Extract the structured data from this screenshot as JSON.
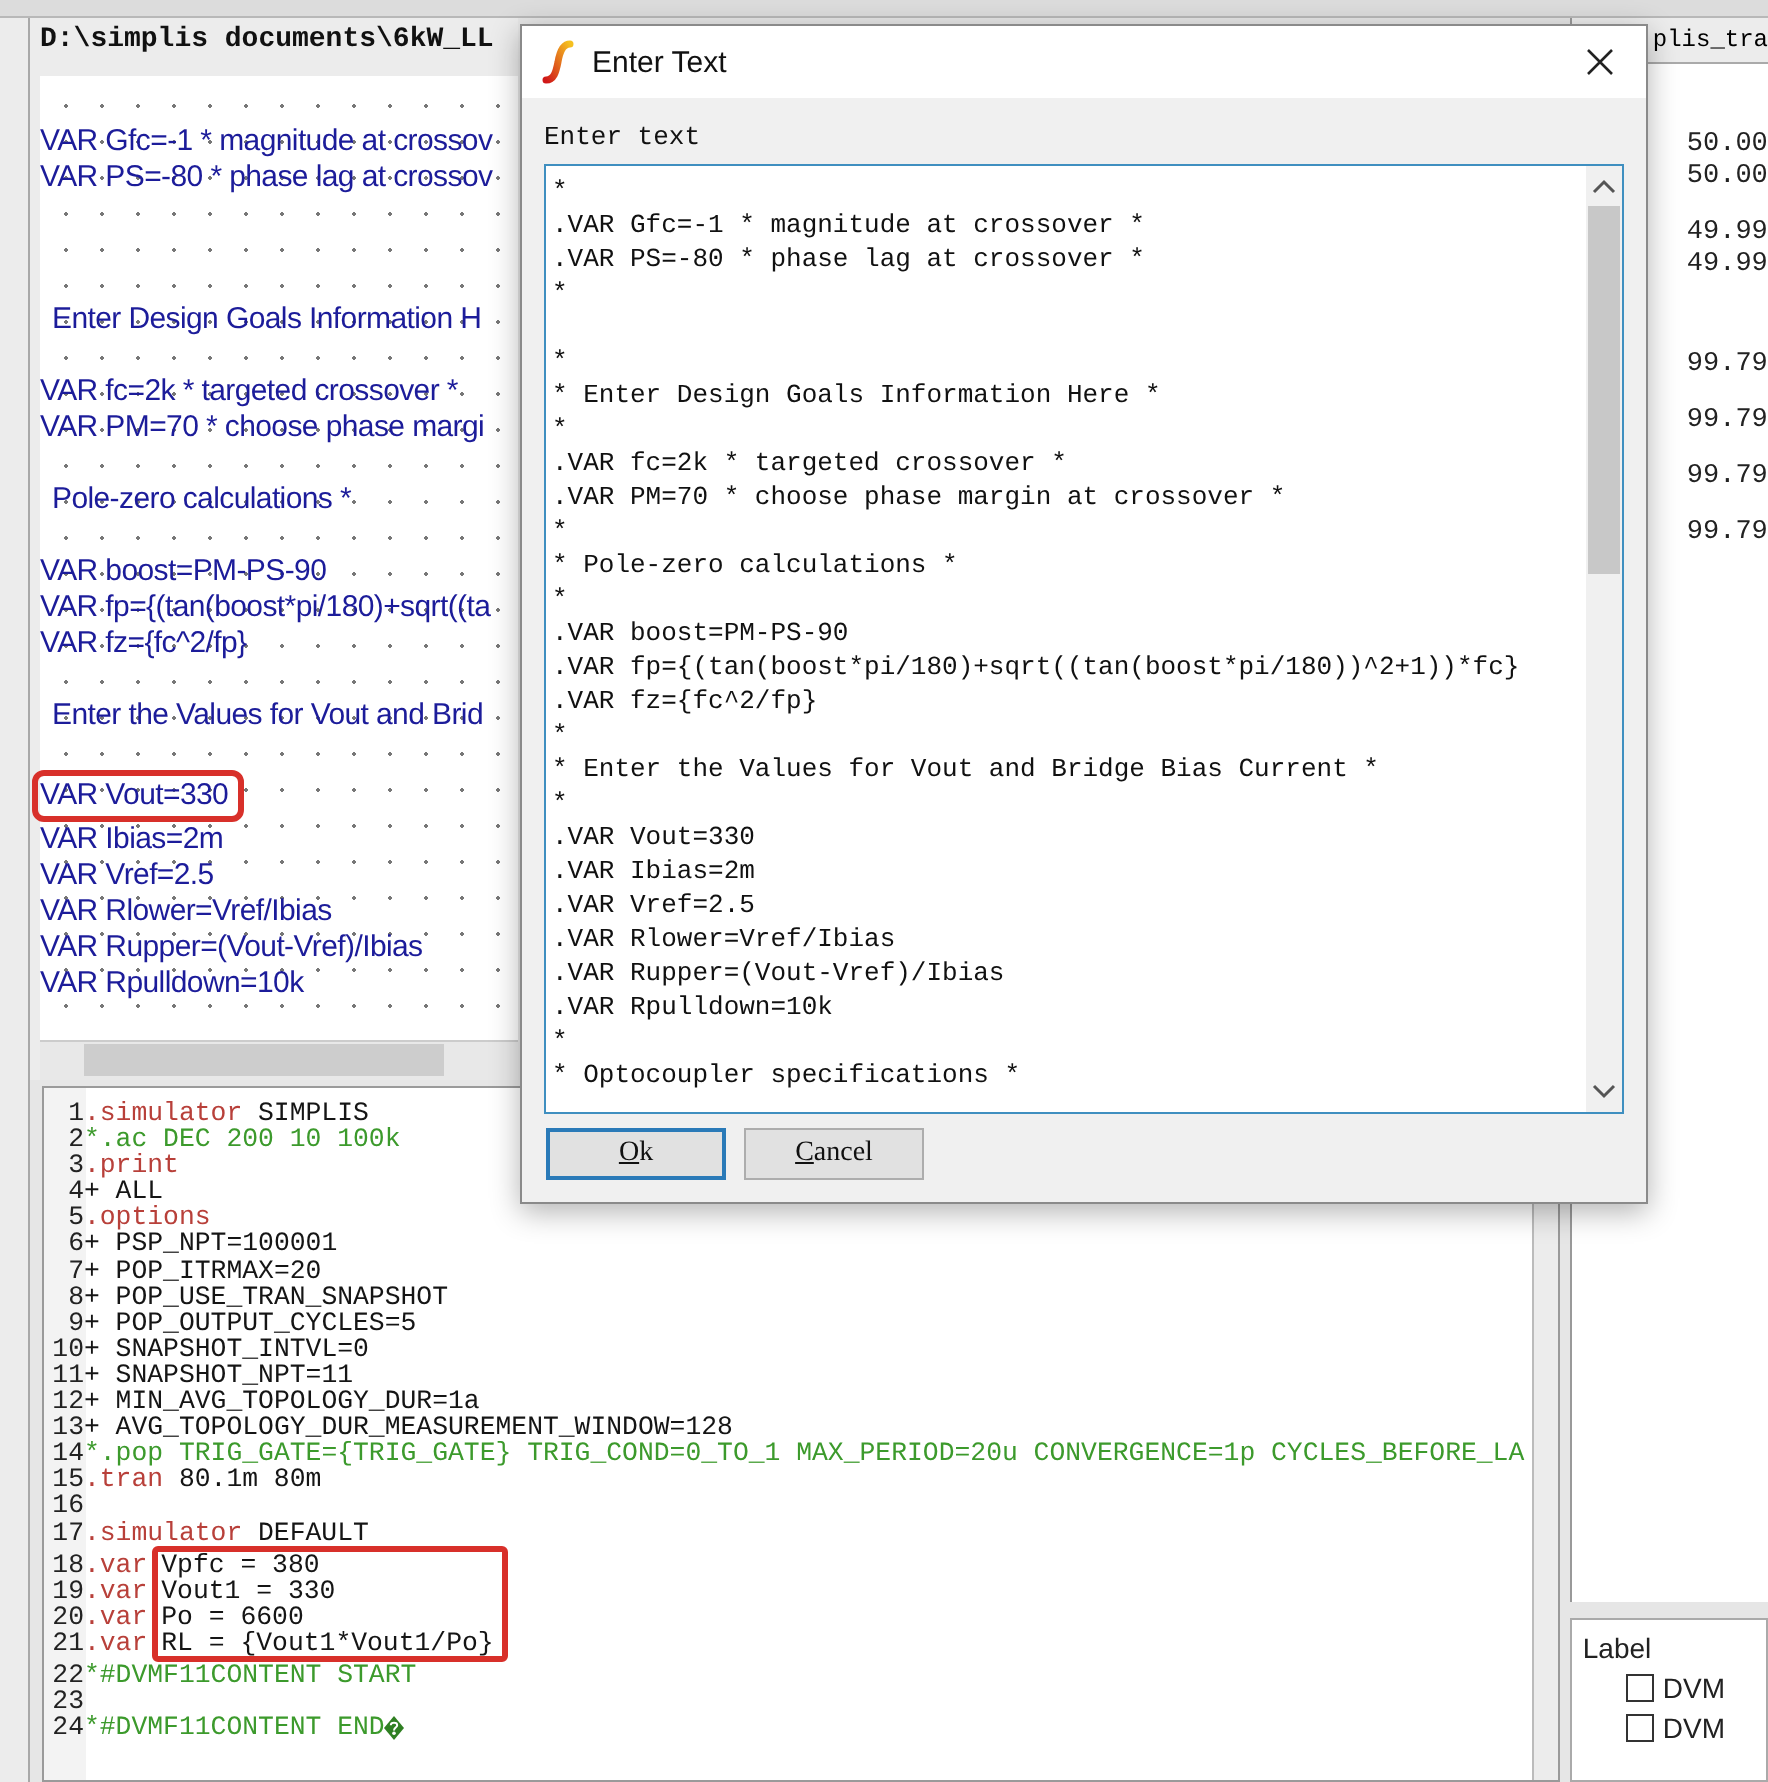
{
  "schematic": {
    "title": "D:\\simplis documents\\6kW_LL",
    "blocks": [
      {
        "lines": [
          {
            "kind": "var",
            "text": "VAR Gfc=-1 * magnitude at crossov"
          },
          {
            "kind": "var",
            "text": "VAR PS=-80 * phase lag at crossov"
          }
        ]
      },
      {
        "lines": [
          {
            "kind": "heading",
            "text": "Enter Design Goals Information H"
          }
        ]
      },
      {
        "lines": [
          {
            "kind": "var",
            "text": "VAR fc=2k * targeted crossover *"
          },
          {
            "kind": "var",
            "text": "VAR PM=70 * choose phase margi"
          }
        ]
      },
      {
        "lines": [
          {
            "kind": "heading",
            "text": "Pole-zero calculations *"
          }
        ]
      },
      {
        "lines": [
          {
            "kind": "var",
            "text": "VAR boost=PM-PS-90"
          },
          {
            "kind": "var",
            "text": "VAR fp={(tan(boost*pi/180)+sqrt((ta"
          },
          {
            "kind": "var",
            "text": "VAR fz={fc^2/fp}"
          }
        ]
      },
      {
        "lines": [
          {
            "kind": "heading",
            "text": "Enter the Values for Vout and Brid"
          }
        ]
      },
      {
        "lines": [
          {
            "kind": "var",
            "text": "VAR Vout=330",
            "highlighted": true
          },
          {
            "kind": "var",
            "text": "VAR Ibias=2m"
          },
          {
            "kind": "var",
            "text": "VAR Vref=2.5"
          },
          {
            "kind": "var",
            "text": "VAR Rlower=Vref/Ibias"
          },
          {
            "kind": "var",
            "text": "VAR Rupper=(Vout-Vref)/Ibias"
          },
          {
            "kind": "var",
            "text": "VAR Rpulldown=10k"
          }
        ]
      }
    ]
  },
  "code_editor": {
    "lines": [
      {
        "number": "1",
        "kind": "directive",
        "keyword": ".simulator",
        "text": "SIMPLIS"
      },
      {
        "number": "2",
        "kind": "comment",
        "text": "*.ac DEC 200 10 100k"
      },
      {
        "number": "3",
        "kind": "directive",
        "keyword": ".print"
      },
      {
        "number": "4",
        "kind": "plain",
        "text": "+ ALL"
      },
      {
        "number": "5",
        "kind": "directive",
        "keyword": ".options"
      },
      {
        "number": "6",
        "kind": "plain",
        "text": "+ PSP_NPT=100001"
      },
      {
        "number": "7",
        "kind": "plain",
        "text": "+ POP_ITRMAX=20"
      },
      {
        "number": "8",
        "kind": "plain",
        "text": "+ POP_USE_TRAN_SNAPSHOT"
      },
      {
        "number": "9",
        "kind": "plain",
        "text": "+ POP_OUTPUT_CYCLES=5"
      },
      {
        "number": "10",
        "kind": "plain",
        "text": "+ SNAPSHOT_INTVL=0"
      },
      {
        "number": "11",
        "kind": "plain",
        "text": "+ SNAPSHOT_NPT=11"
      },
      {
        "number": "12",
        "kind": "plain",
        "text": "+ MIN_AVG_TOPOLOGY_DUR=1a"
      },
      {
        "number": "13",
        "kind": "plain",
        "text": "+ AVG_TOPOLOGY_DUR_MEASUREMENT_WINDOW=128"
      },
      {
        "number": "14",
        "kind": "comment",
        "text": "*.pop TRIG_GATE={TRIG_GATE} TRIG_COND=0_TO_1 MAX_PERIOD=20u CONVERGENCE=1p CYCLES_BEFORE_LA"
      },
      {
        "number": "15",
        "kind": "directive",
        "keyword": ".tran",
        "text": "80.1m 80m"
      },
      {
        "number": "16",
        "kind": "blank"
      },
      {
        "number": "17",
        "kind": "directive",
        "keyword": ".simulator",
        "text": "DEFAULT"
      },
      {
        "number": "18",
        "kind": "directive",
        "keyword": ".var",
        "text": "Vpfc = 380",
        "highlighted": true
      },
      {
        "number": "19",
        "kind": "directive",
        "keyword": ".var",
        "text": "Vout1 = 330",
        "highlighted": true
      },
      {
        "number": "20",
        "kind": "directive",
        "keyword": ".var",
        "text": "Po = 6600",
        "highlighted": true
      },
      {
        "number": "21",
        "kind": "directive",
        "keyword": ".var",
        "text": "RL = {Vout1*Vout1/Po}",
        "highlighted": true
      },
      {
        "number": "22",
        "kind": "comment",
        "text": "*#DVMF11CONTENT START"
      },
      {
        "number": "23",
        "kind": "blank"
      },
      {
        "number": "24",
        "kind": "comment",
        "text": "*#DVMF11CONTENT END",
        "unknown_char": true
      }
    ]
  },
  "side_panel": {
    "title": "plis_tra",
    "groups": [
      [
        "50.00",
        "50.00"
      ],
      [
        "49.99",
        "49.99"
      ],
      [
        "99.79"
      ],
      [
        "99.79"
      ],
      [
        "99.79"
      ],
      [
        "99.79"
      ]
    ]
  },
  "label_panel": {
    "heading": "Label",
    "items": [
      {
        "label": "DVM",
        "checked": false
      },
      {
        "label": "DVM",
        "checked": false
      }
    ]
  },
  "dialog": {
    "title": "Enter Text",
    "label": "Enter text",
    "lines": [
      {
        "kind": "text",
        "text": "*"
      },
      {
        "kind": "text",
        "text": ".VAR Gfc=-1 * magnitude at crossover *"
      },
      {
        "kind": "text",
        "text": ".VAR PS=-80 * phase lag at crossover *"
      },
      {
        "kind": "text",
        "text": "*"
      },
      {
        "kind": "blank"
      },
      {
        "kind": "text",
        "text": "*"
      },
      {
        "kind": "text",
        "text": "* Enter Design Goals Information Here *"
      },
      {
        "kind": "text",
        "text": "*"
      },
      {
        "kind": "text",
        "text": ".VAR fc=2k * targeted crossover *"
      },
      {
        "kind": "text",
        "text": ".VAR PM=70 * choose phase margin at crossover *"
      },
      {
        "kind": "text",
        "text": "*"
      },
      {
        "kind": "text",
        "text": "* Pole-zero calculations *"
      },
      {
        "kind": "text",
        "text": "*"
      },
      {
        "kind": "text",
        "text": ".VAR boost=PM-PS-90"
      },
      {
        "kind": "text",
        "text": ".VAR fp={(tan(boost*pi/180)+sqrt((tan(boost*pi/180))^2+1))*fc}"
      },
      {
        "kind": "text",
        "text": ".VAR fz={fc^2/fp}"
      },
      {
        "kind": "text",
        "text": "*"
      },
      {
        "kind": "text",
        "text": "* Enter the Values for Vout and Bridge Bias Current *"
      },
      {
        "kind": "text",
        "text": "*"
      },
      {
        "kind": "text",
        "text": ".VAR Vout=330"
      },
      {
        "kind": "text",
        "text": ".VAR Ibias=2m"
      },
      {
        "kind": "text",
        "text": ".VAR Vref=2.5"
      },
      {
        "kind": "text",
        "text": ".VAR Rlower=Vref/Ibias"
      },
      {
        "kind": "text",
        "text": ".VAR Rupper=(Vout-Vref)/Ibias"
      },
      {
        "kind": "text",
        "text": ".VAR Rpulldown=10k"
      },
      {
        "kind": "text",
        "text": "*"
      },
      {
        "kind": "text",
        "text": "* Optocoupler specifications *"
      }
    ],
    "buttons": [
      {
        "label": "Ok",
        "focused": true
      },
      {
        "label": "Cancel",
        "focused": false
      }
    ]
  }
}
